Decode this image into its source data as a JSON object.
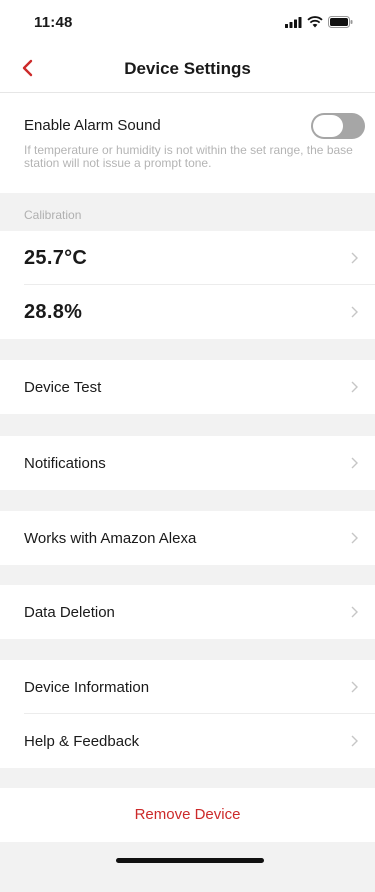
{
  "status_bar": {
    "time": "11:48"
  },
  "nav": {
    "title": "Device Settings",
    "back_icon": "chevron-left-icon",
    "accent_color": "#cc2a2a"
  },
  "alarm": {
    "label": "Enable Alarm Sound",
    "enabled": false,
    "description": "If temperature or humidity is not within the set range, the base station will not issue a prompt tone."
  },
  "calibration": {
    "section_label": "Calibration",
    "temperature": "25.7°C",
    "humidity": "28.8%"
  },
  "menu": {
    "device_test": "Device Test",
    "notifications": "Notifications",
    "alexa": "Works with Amazon Alexa",
    "data_deletion": "Data Deletion",
    "device_information": "Device Information",
    "help_feedback": "Help & Feedback"
  },
  "remove": {
    "label": "Remove Device"
  }
}
